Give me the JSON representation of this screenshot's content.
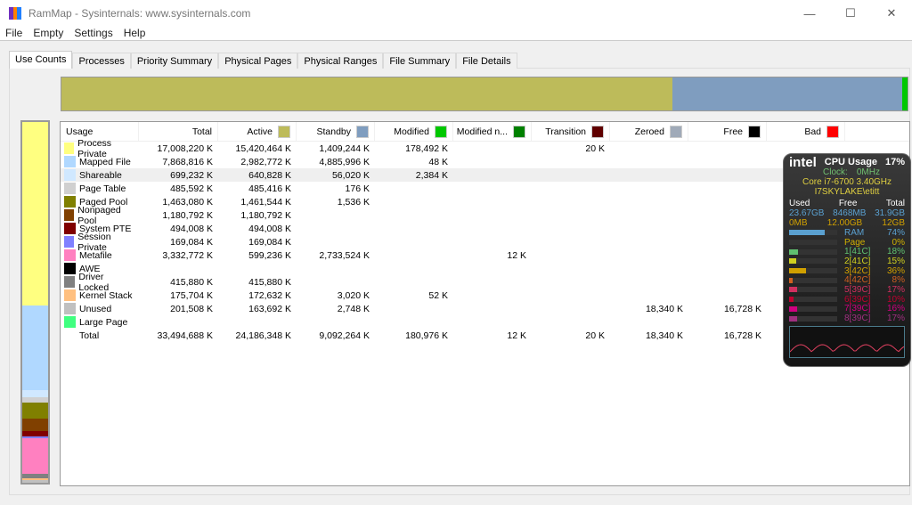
{
  "window": {
    "title": "RamMap - Sysinternals: www.sysinternals.com",
    "minimize": "—",
    "maximize": "☐",
    "close": "✕"
  },
  "menu": [
    "File",
    "Empty",
    "Settings",
    "Help"
  ],
  "tabs": [
    "Use Counts",
    "Processes",
    "Priority Summary",
    "Physical Pages",
    "Physical Ranges",
    "File Summary",
    "File Details"
  ],
  "columns": [
    {
      "label": "Usage"
    },
    {
      "label": "Total"
    },
    {
      "label": "Active",
      "color": "#bdbb5a"
    },
    {
      "label": "Standby",
      "color": "#7f9dbf"
    },
    {
      "label": "Modified",
      "color": "#00c800"
    },
    {
      "label": "Modified n...",
      "color": "#008000"
    },
    {
      "label": "Transition",
      "color": "#600000"
    },
    {
      "label": "Zeroed",
      "color": "#a0aab8"
    },
    {
      "label": "Free",
      "color": "#000000"
    },
    {
      "label": "Bad",
      "color": "#ff0000"
    }
  ],
  "rows": [
    {
      "name": "Process Private",
      "color": "#ffff80",
      "total": "17,008,220 K",
      "active": "15,420,464 K",
      "standby": "1,409,244 K",
      "modified": "178,492 K",
      "modno": "",
      "transition": "20 K",
      "zeroed": "",
      "free": "",
      "bad": "",
      "v": 17008220
    },
    {
      "name": "Mapped File",
      "color": "#b0d8ff",
      "total": "7,868,816 K",
      "active": "2,982,772 K",
      "standby": "4,885,996 K",
      "modified": "48 K",
      "modno": "",
      "transition": "",
      "zeroed": "",
      "free": "",
      "bad": "",
      "v": 7868816
    },
    {
      "name": "Shareable",
      "color": "#d0e8ff",
      "total": "699,232 K",
      "active": "640,828 K",
      "standby": "56,020 K",
      "modified": "2,384 K",
      "modno": "",
      "transition": "",
      "zeroed": "",
      "free": "",
      "bad": "",
      "v": 699232
    },
    {
      "name": "Page Table",
      "color": "#d0d0d0",
      "total": "485,592 K",
      "active": "485,416 K",
      "standby": "176 K",
      "modified": "",
      "modno": "",
      "transition": "",
      "zeroed": "",
      "free": "",
      "bad": "",
      "v": 485592
    },
    {
      "name": "Paged Pool",
      "color": "#808000",
      "total": "1,463,080 K",
      "active": "1,461,544 K",
      "standby": "1,536 K",
      "modified": "",
      "modno": "",
      "transition": "",
      "zeroed": "",
      "free": "",
      "bad": "",
      "v": 1463080
    },
    {
      "name": "Nonpaged Pool",
      "color": "#804000",
      "total": "1,180,792 K",
      "active": "1,180,792 K",
      "standby": "",
      "modified": "",
      "modno": "",
      "transition": "",
      "zeroed": "",
      "free": "",
      "bad": "",
      "v": 1180792
    },
    {
      "name": "System PTE",
      "color": "#800000",
      "total": "494,008 K",
      "active": "494,008 K",
      "standby": "",
      "modified": "",
      "modno": "",
      "transition": "",
      "zeroed": "",
      "free": "",
      "bad": "",
      "v": 494008
    },
    {
      "name": "Session Private",
      "color": "#8080ff",
      "total": "169,084 K",
      "active": "169,084 K",
      "standby": "",
      "modified": "",
      "modno": "",
      "transition": "",
      "zeroed": "",
      "free": "",
      "bad": "",
      "v": 169084
    },
    {
      "name": "Metafile",
      "color": "#ff80c0",
      "total": "3,332,772 K",
      "active": "599,236 K",
      "standby": "2,733,524 K",
      "modified": "",
      "modno": "12 K",
      "transition": "",
      "zeroed": "",
      "free": "",
      "bad": "",
      "v": 3332772
    },
    {
      "name": "AWE",
      "color": "#000000",
      "total": "",
      "active": "",
      "standby": "",
      "modified": "",
      "modno": "",
      "transition": "",
      "zeroed": "",
      "free": "",
      "bad": "",
      "v": 0
    },
    {
      "name": "Driver Locked",
      "color": "#808080",
      "total": "415,880 K",
      "active": "415,880 K",
      "standby": "",
      "modified": "",
      "modno": "",
      "transition": "",
      "zeroed": "",
      "free": "",
      "bad": "",
      "v": 415880
    },
    {
      "name": "Kernel Stack",
      "color": "#ffc080",
      "total": "175,704 K",
      "active": "172,632 K",
      "standby": "3,020 K",
      "modified": "52 K",
      "modno": "",
      "transition": "",
      "zeroed": "",
      "free": "",
      "bad": "",
      "v": 175704
    },
    {
      "name": "Unused",
      "color": "#c0c0c0",
      "total": "201,508 K",
      "active": "163,692 K",
      "standby": "2,748 K",
      "modified": "",
      "modno": "",
      "transition": "",
      "zeroed": "18,340 K",
      "free": "16,728 K",
      "bad": "",
      "v": 201508
    },
    {
      "name": "Large Page",
      "color": "#40ff80",
      "total": "",
      "active": "",
      "standby": "",
      "modified": "",
      "modno": "",
      "transition": "",
      "zeroed": "",
      "free": "",
      "bad": "",
      "v": 0
    }
  ],
  "total_row": {
    "name": "Total",
    "total": "33,494,688 K",
    "active": "24,186,348 K",
    "standby": "9,092,264 K",
    "modified": "180,976 K",
    "modno": "12 K",
    "transition": "20 K",
    "zeroed": "18,340 K",
    "free": "16,728 K",
    "bad": ""
  },
  "summary_bar": [
    {
      "name": "active",
      "value": 24186348,
      "color": "#bdbb5a"
    },
    {
      "name": "standby",
      "value": 9092264,
      "color": "#7f9dbf"
    },
    {
      "name": "modified",
      "value": 180976,
      "color": "#00c800"
    }
  ],
  "widget": {
    "brand": "intel",
    "title": "CPU Usage",
    "cpu": "17%",
    "clock_label": "Clock:",
    "clock": "0MHz",
    "cpu_name": "Core i7-6700 3.40GHz",
    "host": "I7SKYLAKE\\etitt",
    "headers": [
      "Used",
      "Free",
      "Total"
    ],
    "ram_row": [
      "23.67GB",
      "8468MB",
      "31.9GB"
    ],
    "page_row": [
      "0MB",
      "12.00GB",
      "12GB"
    ],
    "bars": [
      {
        "label": "RAM",
        "pct": "74%",
        "value": 74,
        "color": "#5aa0d0"
      },
      {
        "label": "Page",
        "pct": "0%",
        "value": 0,
        "color": "#d0b000"
      },
      {
        "label": "1[41C]",
        "pct": "18%",
        "value": 18,
        "color": "#60c070"
      },
      {
        "label": "2[41C]",
        "pct": "15%",
        "value": 15,
        "color": "#d0d020"
      },
      {
        "label": "3[42C]",
        "pct": "36%",
        "value": 36,
        "color": "#d0a000"
      },
      {
        "label": "4[42C]",
        "pct": "8%",
        "value": 8,
        "color": "#d06020"
      },
      {
        "label": "5[39C]",
        "pct": "17%",
        "value": 17,
        "color": "#d03060"
      },
      {
        "label": "6[39C]",
        "pct": "10%",
        "value": 10,
        "color": "#c00030"
      },
      {
        "label": "7[39C]",
        "pct": "16%",
        "value": 16,
        "color": "#d00080"
      },
      {
        "label": "8[39C]",
        "pct": "17%",
        "value": 17,
        "color": "#a03080"
      }
    ]
  }
}
